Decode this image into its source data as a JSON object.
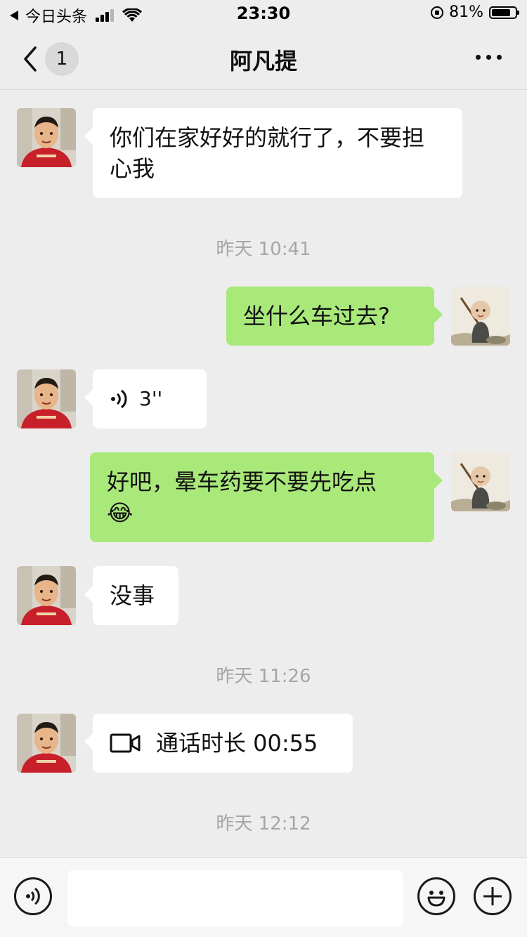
{
  "status_bar": {
    "back_app": "今日头条",
    "time": "23:30",
    "battery_percent": "81%",
    "battery_level": 0.81
  },
  "nav": {
    "unread_count": "1",
    "title": "阿凡提"
  },
  "messages": [
    {
      "side": "left",
      "type": "text",
      "text": "你们在家好好的就行了，不要担心我"
    },
    {
      "side": "center",
      "type": "time",
      "text": "昨天 10:41"
    },
    {
      "side": "right",
      "type": "text",
      "text": "坐什么车过去?"
    },
    {
      "side": "left",
      "type": "voice",
      "text": "3''"
    },
    {
      "side": "right",
      "type": "text",
      "text": "好吧，晕车药要不要先吃点",
      "emoji": "😂"
    },
    {
      "side": "left",
      "type": "text",
      "text": "没事"
    },
    {
      "side": "center",
      "type": "time",
      "text": "昨天 11:26"
    },
    {
      "side": "left",
      "type": "video_call",
      "text": "通话时长 00:55"
    },
    {
      "side": "center",
      "type": "time",
      "text": "昨天 12:12"
    }
  ],
  "input_bar": {
    "placeholder": ""
  },
  "colors": {
    "background": "#ededed",
    "sent_bubble": "#a9e97a",
    "received_bubble": "#ffffff",
    "timestamp": "#a6a6a6"
  },
  "icons": {
    "voice_message": "voice-wave-icon",
    "video_call": "video-camera-icon",
    "input_voice": "voice-input-icon",
    "emoji": "smiley-icon",
    "more": "plus-icon"
  }
}
